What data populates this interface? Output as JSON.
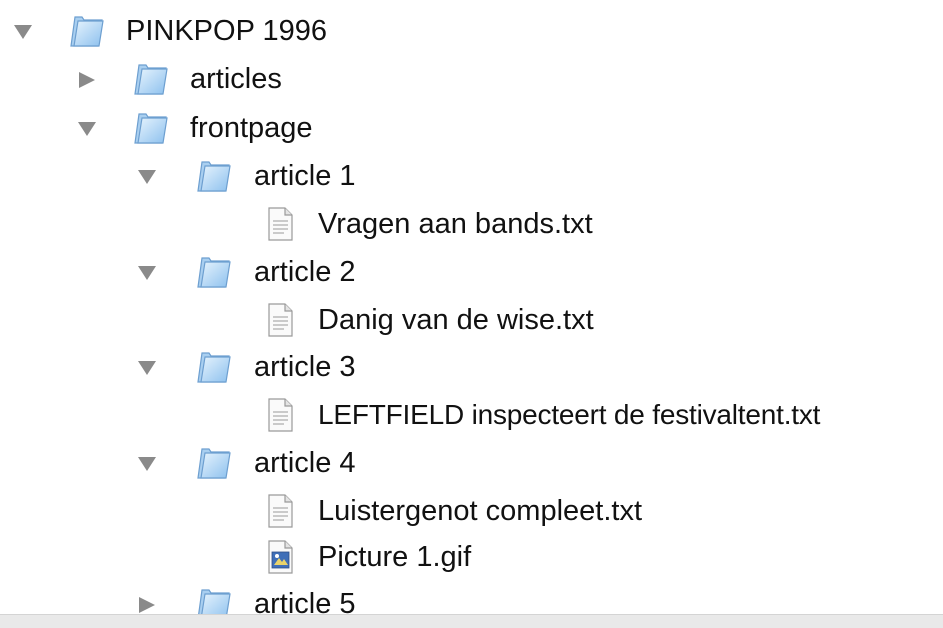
{
  "tree": {
    "root": {
      "name": "PINKPOP 1996",
      "icon": "folder-icon",
      "expanded": true,
      "children": {
        "articles": {
          "name": "articles",
          "icon": "folder-icon",
          "expanded": false
        },
        "frontpage": {
          "name": "frontpage",
          "icon": "folder-icon",
          "expanded": true,
          "children": {
            "article1": {
              "name": "article 1",
              "icon": "folder-icon",
              "expanded": true,
              "files": [
                {
                  "name": "Vragen aan bands.txt",
                  "icon": "text-file-icon"
                }
              ]
            },
            "article2": {
              "name": "article 2",
              "icon": "folder-icon",
              "expanded": true,
              "files": [
                {
                  "name": "Danig van de wise.txt",
                  "icon": "text-file-icon"
                }
              ]
            },
            "article3": {
              "name": "article 3",
              "icon": "folder-icon",
              "expanded": true,
              "files": [
                {
                  "name": "LEFTFIELD inspecteert de festivaltent.txt",
                  "icon": "text-file-icon"
                }
              ]
            },
            "article4": {
              "name": "article 4",
              "icon": "folder-icon",
              "expanded": true,
              "files": [
                {
                  "name": "Luistergenot compleet.txt",
                  "icon": "text-file-icon"
                },
                {
                  "name": "Picture 1.gif",
                  "icon": "image-file-icon"
                }
              ]
            },
            "article5": {
              "name": "article 5",
              "icon": "folder-icon",
              "expanded": false
            }
          }
        }
      }
    }
  },
  "colors": {
    "disclosure_triangle": "#8a8a8a",
    "folder_light": "#cfe6fa",
    "folder_dark": "#7fb6e8",
    "text": "#111111",
    "bottom_bar": "#e9e9e9"
  }
}
